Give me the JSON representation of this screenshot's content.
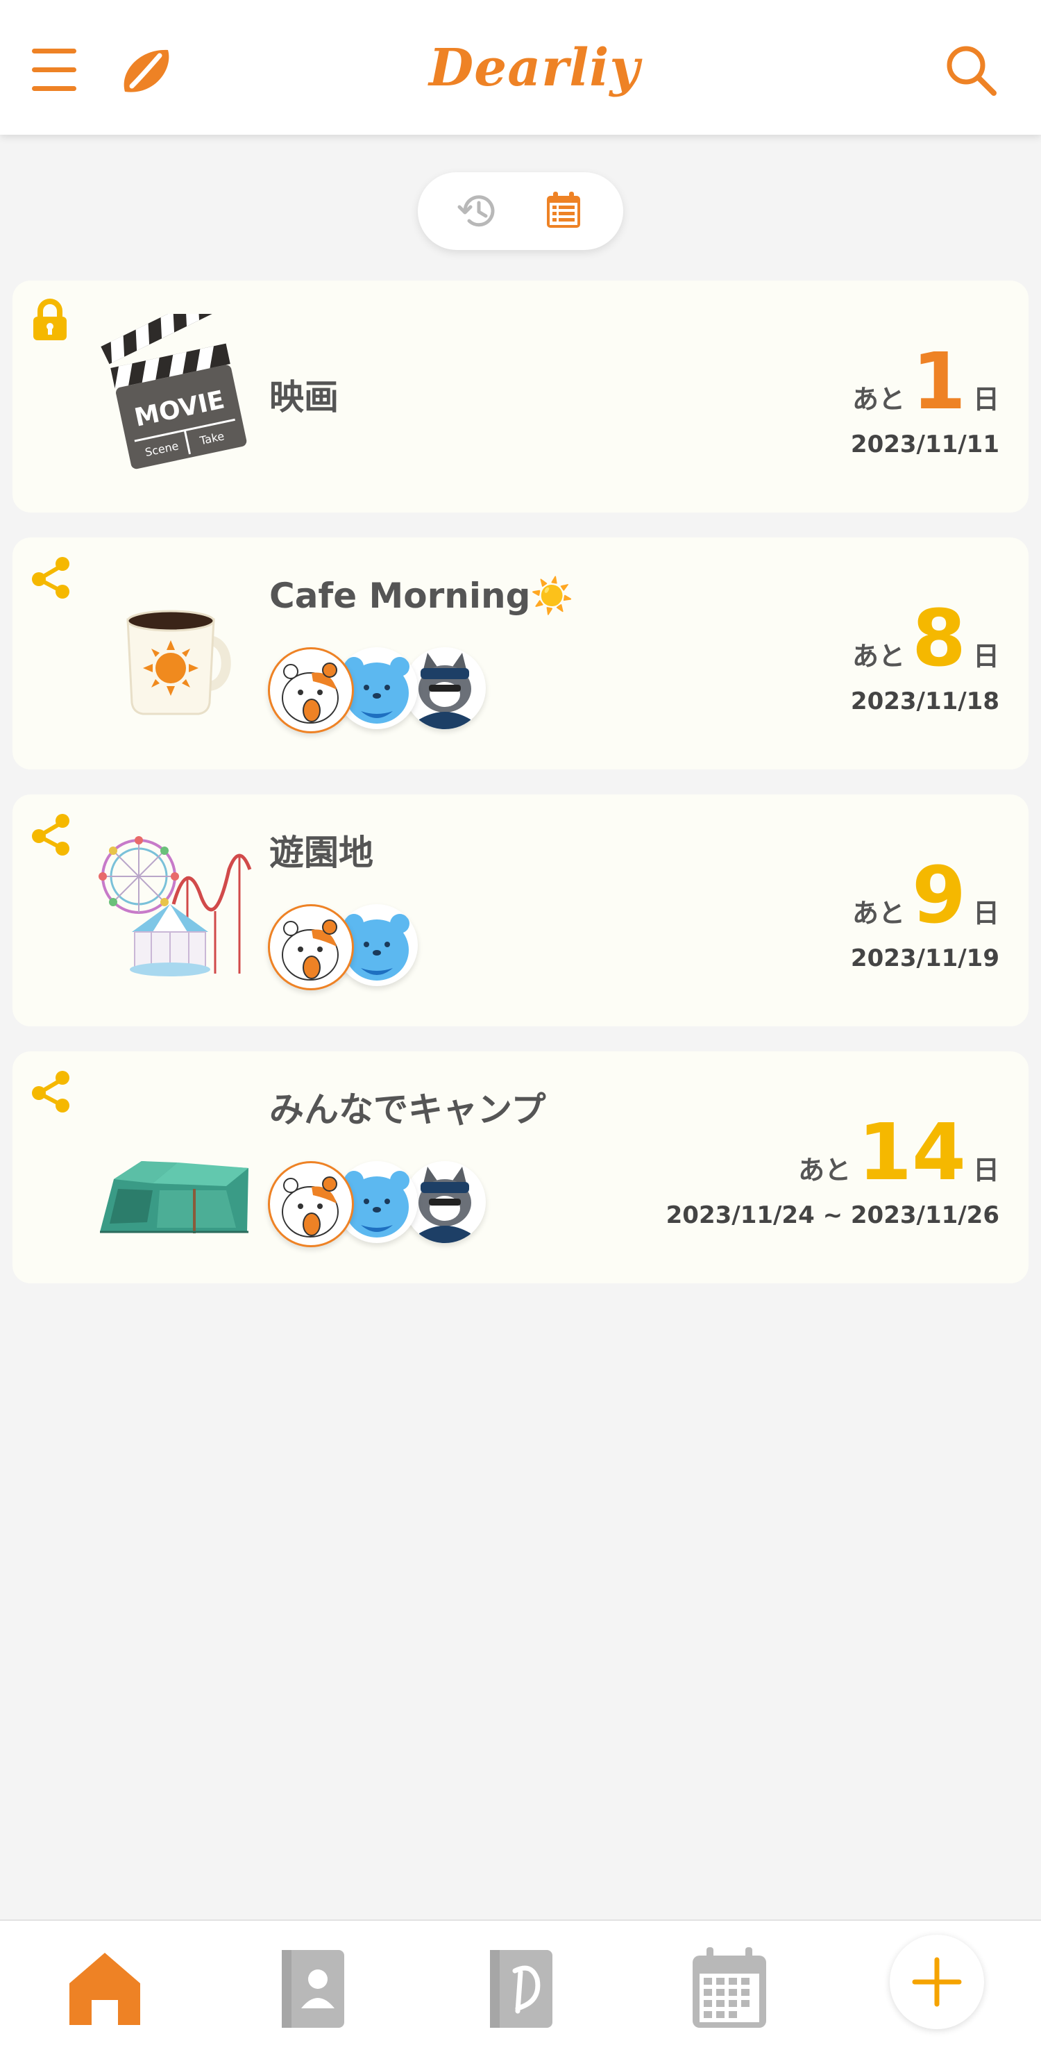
{
  "app": {
    "brand": "Dearliy"
  },
  "colors": {
    "accent": "#ee8225",
    "gold": "#f5b800",
    "muted": "#b8b8b8",
    "text": "#555555"
  },
  "header": {
    "menu_icon": "hamburger-menu-icon",
    "logo_icon": "dearliy-leaf-icon",
    "search_icon": "search-icon"
  },
  "view_toggle": {
    "options": [
      "history",
      "calendar"
    ],
    "selected": "calendar"
  },
  "events": [
    {
      "badge": "lock",
      "title": "映画",
      "prefix": "あと",
      "days": "1",
      "suffix": "日",
      "date": "2023/11/11",
      "members": [],
      "days_color": "#ee8225"
    },
    {
      "badge": "share",
      "title": "Cafe Morning☀️",
      "prefix": "あと",
      "days": "8",
      "suffix": "日",
      "date": "2023/11/18",
      "members": [
        "calico-cat",
        "blue-bear",
        "gray-cat"
      ],
      "days_color": "#f5b800"
    },
    {
      "badge": "share",
      "title": "遊園地",
      "prefix": "あと",
      "days": "9",
      "suffix": "日",
      "date": "2023/11/19",
      "members": [
        "calico-cat",
        "blue-bear"
      ],
      "days_color": "#f5b800"
    },
    {
      "badge": "share",
      "title": "みんなでキャンプ",
      "prefix": "あと",
      "days": "14",
      "suffix": "日",
      "date": "2023/11/24 ~ 2023/11/26",
      "members": [
        "calico-cat",
        "blue-bear",
        "gray-cat"
      ],
      "days_color": "#f5b800"
    }
  ],
  "bottom_nav": {
    "items": [
      "home",
      "contacts",
      "diary",
      "calendar"
    ],
    "selected": "home",
    "add_icon": "plus-icon"
  }
}
